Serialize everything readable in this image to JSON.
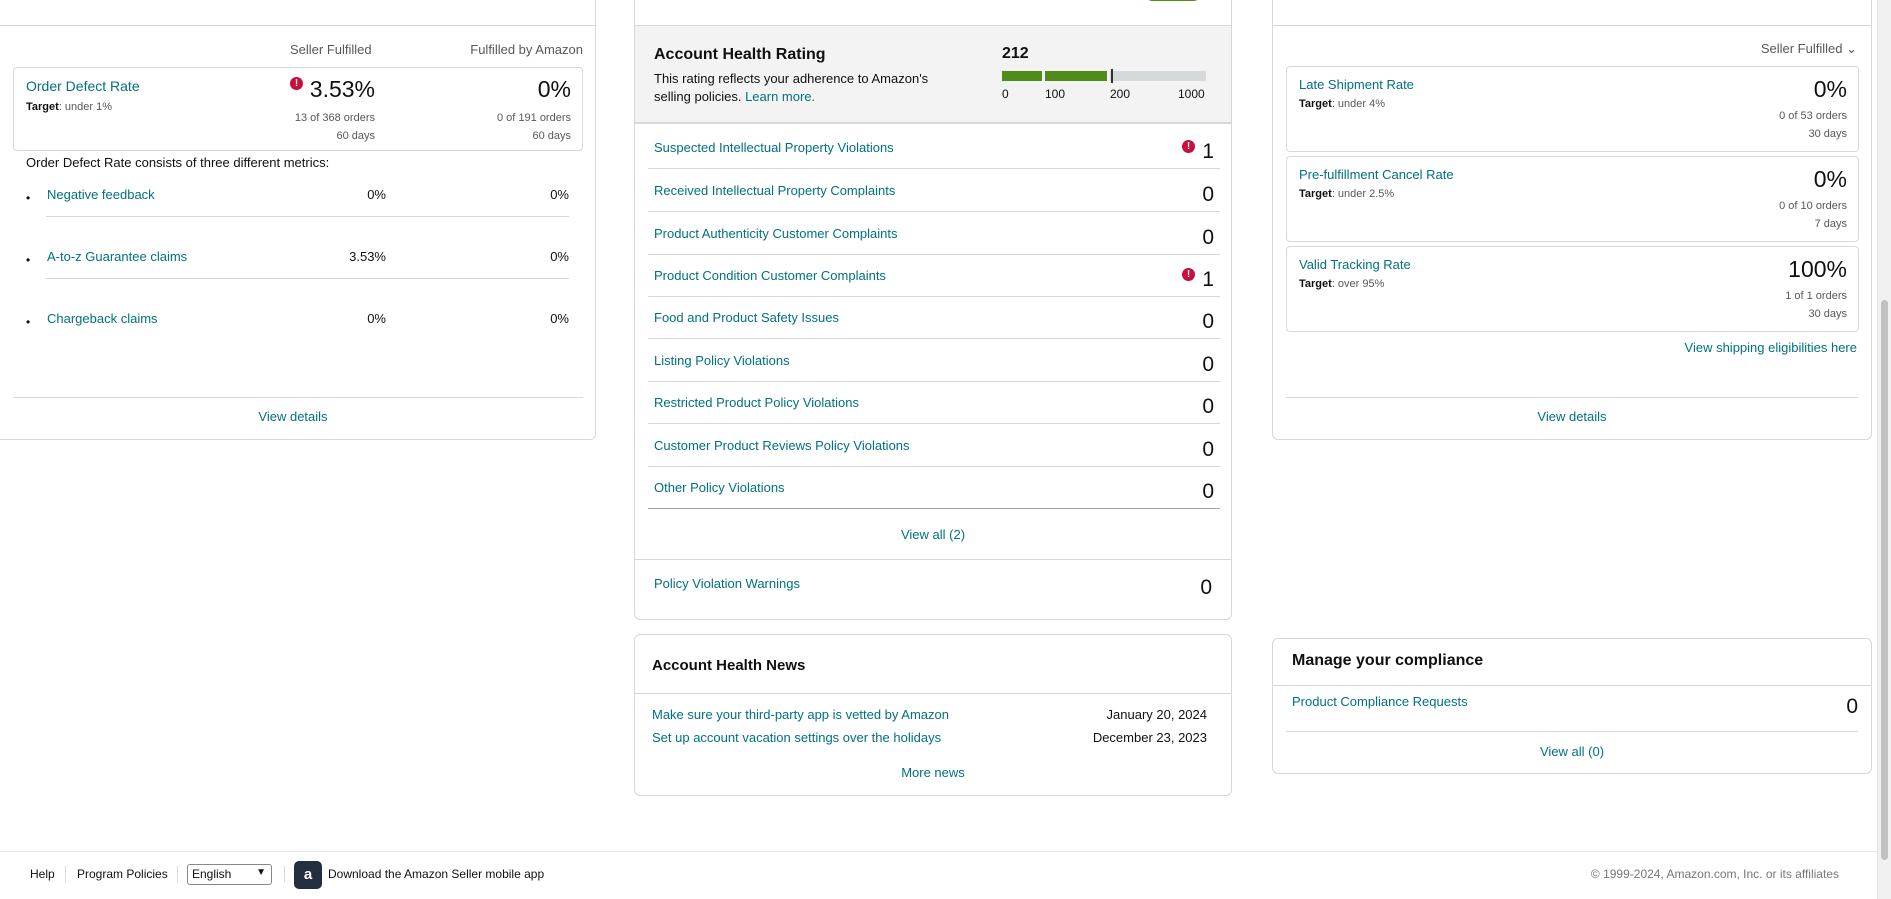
{
  "customer_service": {
    "col_seller": "Seller Fulfilled",
    "col_amazon": "Fulfilled by Amazon",
    "odr": {
      "name": "Order Defect Rate",
      "target_label": "Target",
      "target_value": ": under 1%",
      "seller_value": "3.53%",
      "seller_orders": "13 of 368 orders",
      "seller_period": "60 days",
      "amazon_value": "0%",
      "amazon_orders": "0 of 191 orders",
      "amazon_period": "60 days"
    },
    "consists_text": "Order Defect Rate consists of three different metrics:",
    "metrics": [
      {
        "label": "Negative feedback",
        "seller": "0%",
        "amazon": "0%"
      },
      {
        "label": "A-to-z Guarantee claims",
        "seller": "3.53%",
        "amazon": "0%"
      },
      {
        "label": "Chargeback claims",
        "seller": "0%",
        "amazon": "0%"
      }
    ],
    "view_details": "View details"
  },
  "policy": {
    "ahr_title": "Account Health Rating",
    "ahr_desc": "This rating reflects your adherence to Amazon's selling policies.",
    "ahr_learn_more": "Learn more.",
    "ahr_score": "212",
    "ahr_score_value": 212,
    "ahr_ticks": [
      "0",
      "100",
      "200",
      "1000"
    ],
    "violations": [
      {
        "label": "Suspected Intellectual Property Violations",
        "count": "1",
        "alert": true
      },
      {
        "label": "Received Intellectual Property Complaints",
        "count": "0",
        "alert": false
      },
      {
        "label": "Product Authenticity Customer Complaints",
        "count": "0",
        "alert": false
      },
      {
        "label": "Product Condition Customer Complaints",
        "count": "1",
        "alert": true
      },
      {
        "label": "Food and Product Safety Issues",
        "count": "0",
        "alert": false
      },
      {
        "label": "Listing Policy Violations",
        "count": "0",
        "alert": false
      },
      {
        "label": "Restricted Product Policy Violations",
        "count": "0",
        "alert": false
      },
      {
        "label": "Customer Product Reviews Policy Violations",
        "count": "0",
        "alert": false
      },
      {
        "label": "Other Policy Violations",
        "count": "0",
        "alert": false
      }
    ],
    "view_all": "View all (2)",
    "warnings_label": "Policy Violation Warnings",
    "warnings_count": "0",
    "colors": {
      "good": "#508b1b",
      "empty": "#d5d9d9"
    }
  },
  "news": {
    "title": "Account Health News",
    "items": [
      {
        "title": "Make sure your third-party app is vetted by Amazon",
        "date": "January 20, 2024"
      },
      {
        "title": "Set up account vacation settings over the holidays",
        "date": "December 23, 2023"
      }
    ],
    "more": "More news"
  },
  "shipping": {
    "selector": "Seller Fulfilled",
    "metrics": [
      {
        "name": "Late Shipment Rate",
        "target_label": "Target",
        "target_value": ": under 4%",
        "value": "0%",
        "orders": "0 of 53 orders",
        "period": "30 days"
      },
      {
        "name": "Pre-fulfillment Cancel Rate",
        "target_label": "Target",
        "target_value": ": under 2.5%",
        "value": "0%",
        "orders": "0 of 10 orders",
        "period": "7 days"
      },
      {
        "name": "Valid Tracking Rate",
        "target_label": "Target",
        "target_value": ": over 95%",
        "value": "100%",
        "orders": "1 of 1 orders",
        "period": "30 days"
      }
    ],
    "eligibilities": "View shipping eligibilities here",
    "view_details": "View details"
  },
  "compliance": {
    "title": "Manage your compliance",
    "row_label": "Product Compliance Requests",
    "row_count": "0",
    "view_all": "View all (0)"
  },
  "footer": {
    "help": "Help",
    "program_policies": "Program Policies",
    "language": "English",
    "app_icon": "a",
    "download": "Download the Amazon Seller mobile app",
    "copyright": "© 1999-2024, Amazon.com, Inc. or its affiliates"
  },
  "icons": {
    "alert": "!",
    "chevron": "⌄",
    "select_chevron": "▼",
    "bullet": "•"
  }
}
